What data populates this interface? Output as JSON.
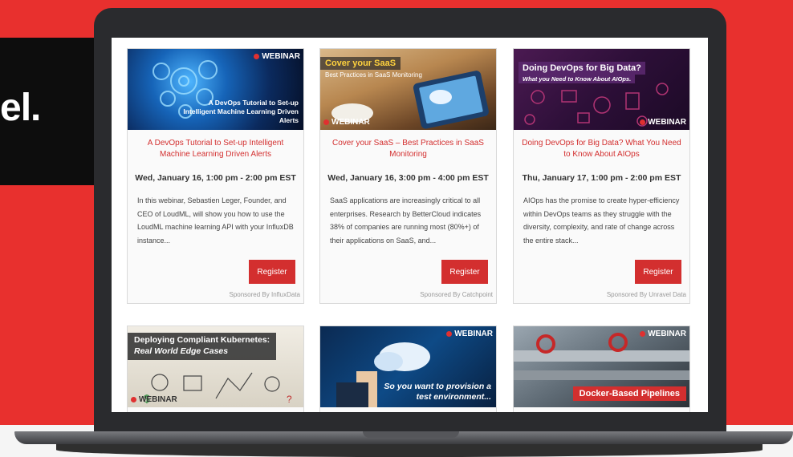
{
  "hero": {
    "text_fragment": "el."
  },
  "cards": [
    {
      "image_heading": "A DevOps Tutorial to Set-up Intelligent Machine Learning Driven Alerts",
      "badge": "WEBINAR",
      "title": "A DevOps Tutorial to Set-up Intelligent Machine Learning Driven Alerts",
      "date": "Wed, January 16, 1:00 pm - 2:00 pm EST",
      "description": "In this webinar, Sebastien Leger, Founder, and CEO of LoudML, will show you how to use the LoudML machine learning API with your InfluxDB instance...",
      "register": "Register",
      "sponsor": "Sponsored By InfluxData"
    },
    {
      "image_heading": "Cover your SaaS",
      "image_subheading": "Best Practices in SaaS Monitoring",
      "badge": "WEBINAR",
      "title": "Cover your SaaS – Best Practices in SaaS Monitoring",
      "date": "Wed, January 16, 3:00 pm - 4:00 pm EST",
      "description": "SaaS applications are increasingly critical to all enterprises. Research by BetterCloud indicates 38% of companies are running most (80%+) of their applications on SaaS, and...",
      "register": "Register",
      "sponsor": "Sponsored By Catchpoint"
    },
    {
      "image_heading": "Doing DevOps for Big Data?",
      "image_subheading": "What you Need to Know About AIOps.",
      "badge": "WEBINAR",
      "title": "Doing DevOps for Big Data? What You Need to Know About AIOps",
      "date": "Thu, January 17, 1:00 pm - 2:00 pm EST",
      "description": "AIOps has the promise to create hyper-efficiency within DevOps teams as they struggle with the diversity, complexity, and rate of change across the entire stack...",
      "register": "Register",
      "sponsor": "Sponsored By Unravel Data"
    },
    {
      "image_heading": "Deploying Compliant Kubernetes:",
      "image_subheading": "Real World Edge Cases",
      "badge": "WEBINAR"
    },
    {
      "image_heading": "So you want to provision a test environment...",
      "badge": "WEBINAR"
    },
    {
      "image_heading": "Docker-Based Pipelines",
      "badge": "WEBINAR"
    }
  ],
  "colors": {
    "brand_red": "#d32f2f",
    "background_red": "#e8302e"
  }
}
